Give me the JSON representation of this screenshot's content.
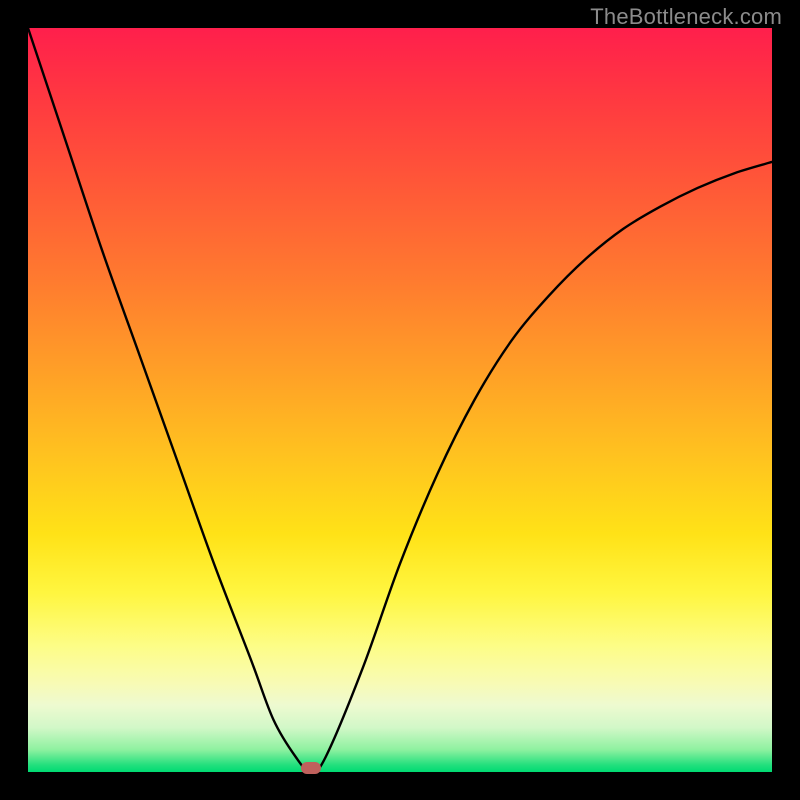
{
  "watermark": "TheBottleneck.com",
  "colors": {
    "frame": "#000000",
    "curve": "#000000",
    "marker": "#c0605c",
    "gradient_top": "#ff1f4c",
    "gradient_bottom": "#00da72"
  },
  "chart_data": {
    "type": "line",
    "title": "",
    "xlabel": "",
    "ylabel": "",
    "xlim": [
      0,
      100
    ],
    "ylim": [
      0,
      100
    ],
    "grid": false,
    "legend": false,
    "annotations": [
      {
        "text": "TheBottleneck.com",
        "position": "top-right"
      }
    ],
    "series": [
      {
        "name": "bottleneck-curve",
        "note": "V-shaped curve; minimum marks balanced (no-bottleneck) point. x is relative hardware balance, y is estimated bottleneck %. Values estimated from pixel positions.",
        "x": [
          0,
          5,
          10,
          15,
          20,
          25,
          30,
          33,
          36,
          38,
          40,
          45,
          50,
          55,
          60,
          65,
          70,
          75,
          80,
          85,
          90,
          95,
          100
        ],
        "y": [
          100,
          85,
          70,
          56,
          42,
          28,
          15,
          7,
          2,
          0,
          2,
          14,
          28,
          40,
          50,
          58,
          64,
          69,
          73,
          76,
          78.5,
          80.5,
          82
        ]
      }
    ],
    "marker": {
      "name": "optimal-point",
      "x": 38,
      "y": 0
    }
  }
}
